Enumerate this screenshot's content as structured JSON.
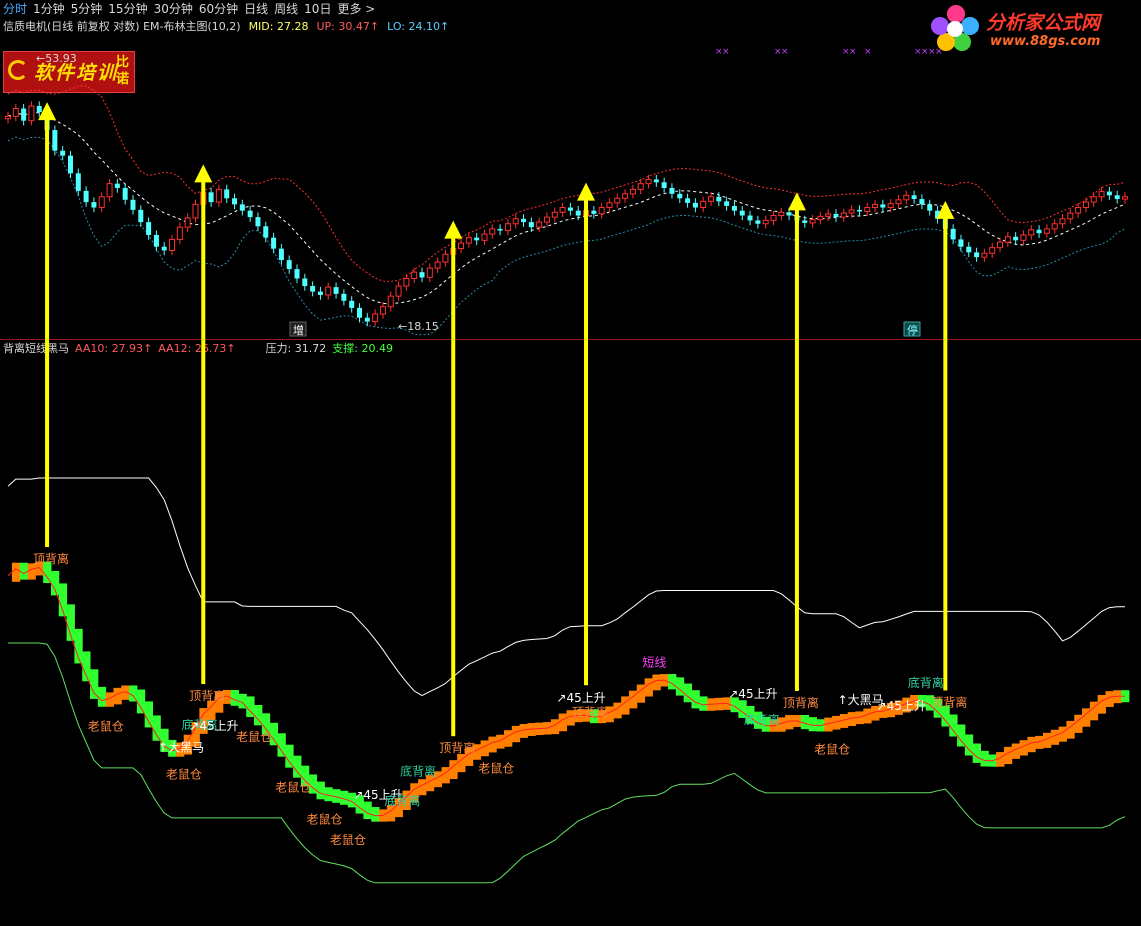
{
  "topbar": {
    "items": [
      "分时",
      "1分钟",
      "5分钟",
      "15分钟",
      "30分钟",
      "60分钟",
      "日线",
      "周线",
      "10日",
      "更多 >"
    ],
    "active_index": 0
  },
  "brand": {
    "name": "分析家公式网",
    "url": "www.88gs.com"
  },
  "logo": {
    "text": "软件培训",
    "side": "比诺"
  },
  "main_panel": {
    "title": "信质电机(日线 前复权 对数) EM-布林主图(10,2)",
    "mid_label": "MID:",
    "mid_value": "27.28",
    "up_label": "UP:",
    "up_value": "30.47",
    "lo_label": "LO:",
    "lo_value": "24.10",
    "high_price": "53.93",
    "low_price": "18.15",
    "zeng_tag": "增",
    "ting_tag": "停"
  },
  "sub_panel": {
    "title": "背离短线黑马",
    "aa10_label": "AA10:",
    "aa10_value": "27.93",
    "aa12_label": "AA12:",
    "aa12_value": "26.73",
    "pressure_label": "压力:",
    "pressure_value": "31.72",
    "support_label": "支撑:",
    "support_value": "20.49"
  },
  "colors": {
    "bull": "#ff3030",
    "bear": "#50ffff",
    "mid": "#ffffff",
    "upper": "#ff3030",
    "lower": "#2a8aa8",
    "arrow": "#ffff00",
    "orange": "#ff8000",
    "green": "#30ff30",
    "pressure": "#ffffff",
    "support": "#60e060",
    "label_orange": "#ff8a40",
    "label_green": "#30d0a0",
    "label_white": "#ffffff",
    "label_magenta": "#ff40ff"
  },
  "chart_data": [
    {
      "type": "candlestick",
      "series_names": [
        "MID",
        "UP",
        "LO"
      ],
      "annotated_values": {
        "high": 53.93,
        "low": 18.15,
        "mid": 27.28,
        "up": 30.47,
        "lo": 24.1
      },
      "closes": [
        44.0,
        45.5,
        43.2,
        46.0,
        44.8,
        41.5,
        38.0,
        37.2,
        34.5,
        32.0,
        30.5,
        29.8,
        31.2,
        33.0,
        32.4,
        30.8,
        29.5,
        28.0,
        26.5,
        25.2,
        24.8,
        26.0,
        27.4,
        28.5,
        30.2,
        31.8,
        30.5,
        32.2,
        31.0,
        30.2,
        29.4,
        28.6,
        27.5,
        26.2,
        25.0,
        23.8,
        22.9,
        22.0,
        21.3,
        20.8,
        20.5,
        21.2,
        20.6,
        20.0,
        19.4,
        18.6,
        18.3,
        18.9,
        19.5,
        20.4,
        21.3,
        22.0,
        22.6,
        22.1,
        23.0,
        23.6,
        24.4,
        25.0,
        25.6,
        26.2,
        25.9,
        26.6,
        27.2,
        27.0,
        27.8,
        28.4,
        28.0,
        27.4,
        28.0,
        28.6,
        29.2,
        29.8,
        29.4,
        28.8,
        29.4,
        29.0,
        29.8,
        30.4,
        31.0,
        31.6,
        32.2,
        33.0,
        33.6,
        33.2,
        32.4,
        31.6,
        31.0,
        30.4,
        29.8,
        30.6,
        31.2,
        30.6,
        30.0,
        29.4,
        28.8,
        28.2,
        27.8,
        28.2,
        28.8,
        29.2,
        28.8,
        28.2,
        27.9,
        28.3,
        28.7,
        29.0,
        28.6,
        29.1,
        29.5,
        29.3,
        29.8,
        30.2,
        29.8,
        30.3,
        30.8,
        31.4,
        30.9,
        30.2,
        29.4,
        28.4,
        27.2,
        26.0,
        25.2,
        24.6,
        24.1,
        24.5,
        25.1,
        25.7,
        26.3,
        25.9,
        26.5,
        27.1,
        26.7,
        27.2,
        27.8,
        28.4,
        29.1,
        29.8,
        30.5,
        31.2,
        31.9,
        31.4,
        30.9,
        31.2
      ]
    },
    {
      "type": "line",
      "name": "背离短线黑马",
      "annotated_values": {
        "AA10": 27.93,
        "AA12": 26.73,
        "压力": 31.72,
        "支撑": 20.49
      },
      "signal_labels": [
        {
          "text": "顶背离",
          "kind": "orange",
          "index": 5
        },
        {
          "text": "顶背离",
          "kind": "orange",
          "index": 25
        },
        {
          "text": "底背离",
          "kind": "green",
          "index": 24
        },
        {
          "text": "老鼠仓",
          "kind": "orange",
          "index": 12
        },
        {
          "text": "↑大黑马",
          "kind": "white",
          "index": 21
        },
        {
          "text": "↗45上升",
          "kind": "white",
          "index": 25
        },
        {
          "text": "老鼠仓",
          "kind": "orange",
          "index": 31
        },
        {
          "text": "老鼠仓",
          "kind": "orange",
          "index": 22
        },
        {
          "text": "老鼠仓",
          "kind": "orange",
          "index": 36
        },
        {
          "text": "老鼠仓",
          "kind": "orange",
          "index": 40
        },
        {
          "text": "老鼠仓",
          "kind": "orange",
          "index": 43
        },
        {
          "text": "↗45上升",
          "kind": "white",
          "index": 46
        },
        {
          "text": "底背离",
          "kind": "green",
          "index": 50
        },
        {
          "text": "底背离",
          "kind": "green",
          "index": 52
        },
        {
          "text": "顶背离",
          "kind": "orange",
          "index": 57
        },
        {
          "text": "老鼠仓",
          "kind": "orange",
          "index": 62
        },
        {
          "text": "↗45上升",
          "kind": "white",
          "index": 72
        },
        {
          "text": "顶背离",
          "kind": "orange",
          "index": 74
        },
        {
          "text": "短线",
          "kind": "magenta",
          "index": 83
        },
        {
          "text": "↗45上升",
          "kind": "white",
          "index": 94
        },
        {
          "text": "底背离",
          "kind": "green",
          "index": 96
        },
        {
          "text": "顶背离",
          "kind": "orange",
          "index": 101
        },
        {
          "text": "老鼠仓",
          "kind": "orange",
          "index": 105
        },
        {
          "text": "↑大黑马",
          "kind": "white",
          "index": 108
        },
        {
          "text": "↗45上升",
          "kind": "white",
          "index": 113
        },
        {
          "text": "底背离",
          "kind": "green",
          "index": 117
        },
        {
          "text": "顶背离",
          "kind": "orange",
          "index": 120
        }
      ]
    }
  ]
}
